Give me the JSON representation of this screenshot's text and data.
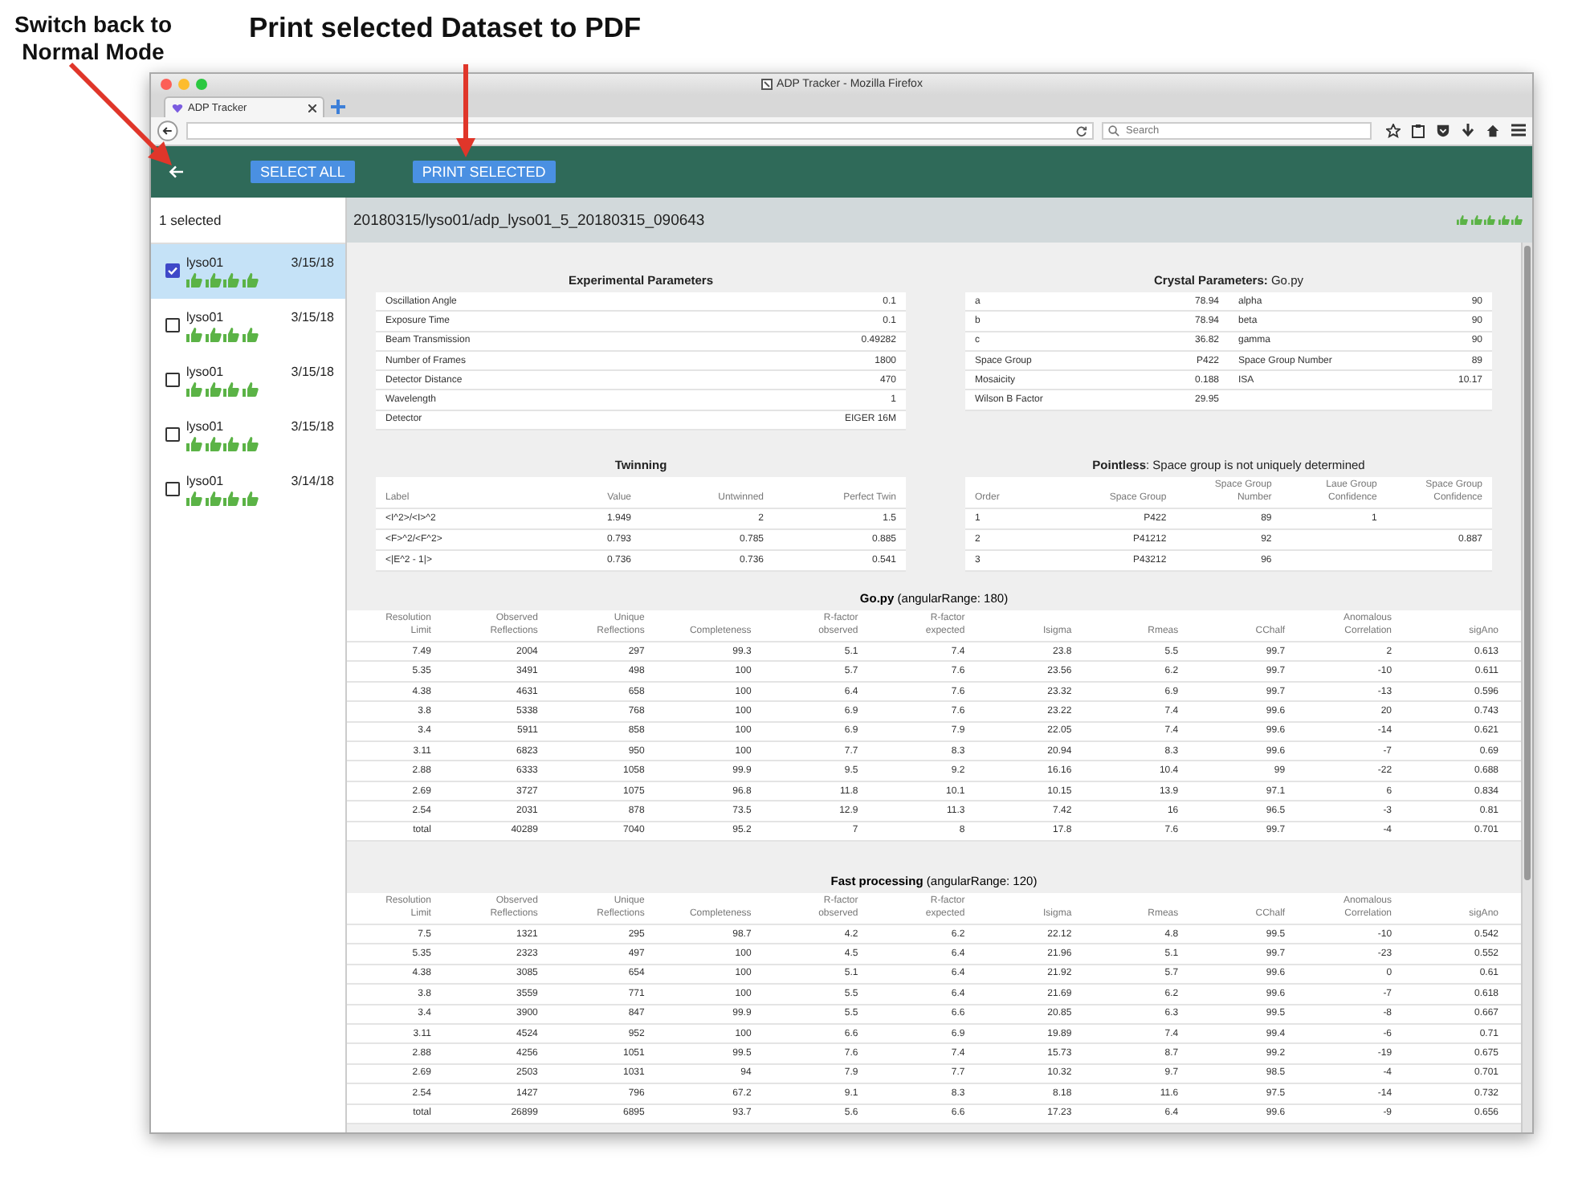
{
  "annotations": [
    {
      "text": "Switch back to Normal Mode"
    },
    {
      "text": "Print selected Dataset to PDF"
    }
  ],
  "browser": {
    "window_title": "ADP Tracker - Mozilla Firefox",
    "tab_title": "ADP Tracker",
    "search_placeholder": "Search"
  },
  "toolbar": {
    "buttons": [
      "SELECT ALL",
      "PRINT SELECTED"
    ]
  },
  "sidebar": {
    "header": "1 selected",
    "items": [
      {
        "name": "lyso01",
        "date": "3/15/18",
        "checked": true,
        "selected": true,
        "stars": 4
      },
      {
        "name": "lyso01",
        "date": "3/15/18",
        "checked": false,
        "selected": false,
        "stars": 4
      },
      {
        "name": "lyso01",
        "date": "3/15/18",
        "checked": false,
        "selected": false,
        "stars": 4
      },
      {
        "name": "lyso01",
        "date": "3/15/18",
        "checked": false,
        "selected": false,
        "stars": 4
      },
      {
        "name": "lyso01",
        "date": "3/14/18",
        "checked": false,
        "selected": false,
        "stars": 4
      }
    ]
  },
  "detail": {
    "path": "20180315/lyso01/adp_lyso01_5_20180315_090643",
    "stars": 5,
    "experimental": {
      "title": "Experimental Parameters",
      "rows": [
        [
          "Oscillation Angle",
          "0.1"
        ],
        [
          "Exposure Time",
          "0.1"
        ],
        [
          "Beam Transmission",
          "0.49282"
        ],
        [
          "Number of Frames",
          "1800"
        ],
        [
          "Detector Distance",
          "470"
        ],
        [
          "Wavelength",
          "1"
        ],
        [
          "Detector",
          "EIGER 16M"
        ]
      ]
    },
    "crystal": {
      "title": "**Crystal Parameters:** Go.py",
      "rows": [
        [
          "a",
          "78.94",
          "alpha",
          "90"
        ],
        [
          "b",
          "78.94",
          "beta",
          "90"
        ],
        [
          "c",
          "36.82",
          "gamma",
          "90"
        ],
        [
          "Space Group",
          "P422",
          "Space Group Number",
          "89"
        ],
        [
          "Mosaicity",
          "0.188",
          "ISA",
          "10.17"
        ],
        [
          "Wilson B Factor",
          "29.95"
        ]
      ]
    },
    "twinning": {
      "title": "Twinning",
      "columns": [
        "Label",
        "Value",
        "Untwinned",
        "Perfect Twin"
      ],
      "rows": [
        [
          "<I^2>/<I>^2",
          "1.949",
          "2",
          "1.5"
        ],
        [
          "<F>^2/<F^2>",
          "0.793",
          "0.785",
          "0.885"
        ],
        [
          "<|E^2 - 1|>",
          "0.736",
          "0.736",
          "0.541"
        ]
      ]
    },
    "pointless": {
      "title": "**Pointless**: Space group is not uniquely determined",
      "columns": [
        "Order",
        "Space Group",
        "Space Group Number",
        "Laue Group Confidence",
        "Space Group Confidence"
      ],
      "rows": [
        [
          "1",
          "P422",
          "89",
          "1",
          null
        ],
        [
          "2",
          "P41212",
          "92",
          null,
          "0.887"
        ],
        [
          "3",
          "P43212",
          "96",
          null,
          null
        ]
      ]
    },
    "processing": [
      {
        "title": "**Go.py** (angularRange: 180)",
        "columns": [
          "Resolution Limit",
          "Observed Reflections",
          "Unique Reflections",
          "Completeness",
          "R-factor observed",
          "R-factor expected",
          "Isigma",
          "Rmeas",
          "CChalf",
          "Anomalous Correlation",
          "sigAno"
        ],
        "rows": [
          [
            "7.49",
            "2004",
            "297",
            "99.3",
            "5.1",
            "7.4",
            "23.8",
            "5.5",
            "99.7",
            "2",
            "0.613"
          ],
          [
            "5.35",
            "3491",
            "498",
            "100",
            "5.7",
            "7.6",
            "23.56",
            "6.2",
            "99.7",
            "-10",
            "0.611"
          ],
          [
            "4.38",
            "4631",
            "658",
            "100",
            "6.4",
            "7.6",
            "23.32",
            "6.9",
            "99.7",
            "-13",
            "0.596"
          ],
          [
            "3.8",
            "5338",
            "768",
            "100",
            "6.9",
            "7.6",
            "23.22",
            "7.4",
            "99.6",
            "20",
            "0.743"
          ],
          [
            "3.4",
            "5911",
            "858",
            "100",
            "6.9",
            "7.9",
            "22.05",
            "7.4",
            "99.6",
            "-14",
            "0.621"
          ],
          [
            "3.11",
            "6823",
            "950",
            "100",
            "7.7",
            "8.3",
            "20.94",
            "8.3",
            "99.6",
            "-7",
            "0.69"
          ],
          [
            "2.88",
            "6333",
            "1058",
            "99.9",
            "9.5",
            "9.2",
            "16.16",
            "10.4",
            "99",
            "-22",
            "0.688"
          ],
          [
            "2.69",
            "3727",
            "1075",
            "96.8",
            "11.8",
            "10.1",
            "10.15",
            "13.9",
            "97.1",
            "6",
            "0.834"
          ],
          [
            "2.54",
            "2031",
            "878",
            "73.5",
            "12.9",
            "11.3",
            "7.42",
            "16",
            "96.5",
            "-3",
            "0.81"
          ],
          [
            "total",
            "40289",
            "7040",
            "95.2",
            "7",
            "8",
            "17.8",
            "7.6",
            "99.7",
            "-4",
            "0.701"
          ]
        ]
      },
      {
        "title": "**Fast processing** (angularRange: 120)",
        "columns": [
          "Resolution Limit",
          "Observed Reflections",
          "Unique Reflections",
          "Completeness",
          "R-factor observed",
          "R-factor expected",
          "Isigma",
          "Rmeas",
          "CChalf",
          "Anomalous Correlation",
          "sigAno"
        ],
        "rows": [
          [
            "7.5",
            "1321",
            "295",
            "98.7",
            "4.2",
            "6.2",
            "22.12",
            "4.8",
            "99.5",
            "-10",
            "0.542"
          ],
          [
            "5.35",
            "2323",
            "497",
            "100",
            "4.5",
            "6.4",
            "21.96",
            "5.1",
            "99.7",
            "-23",
            "0.552"
          ],
          [
            "4.38",
            "3085",
            "654",
            "100",
            "5.1",
            "6.4",
            "21.92",
            "5.7",
            "99.6",
            "0",
            "0.61"
          ],
          [
            "3.8",
            "3559",
            "771",
            "100",
            "5.5",
            "6.4",
            "21.69",
            "6.2",
            "99.6",
            "-7",
            "0.618"
          ],
          [
            "3.4",
            "3900",
            "847",
            "99.9",
            "5.5",
            "6.6",
            "20.85",
            "6.3",
            "99.5",
            "-8",
            "0.667"
          ],
          [
            "3.11",
            "4524",
            "952",
            "100",
            "6.6",
            "6.9",
            "19.89",
            "7.4",
            "99.4",
            "-6",
            "0.71"
          ],
          [
            "2.88",
            "4256",
            "1051",
            "99.5",
            "7.6",
            "7.4",
            "15.73",
            "8.7",
            "99.2",
            "-19",
            "0.675"
          ],
          [
            "2.69",
            "2503",
            "1031",
            "94",
            "7.9",
            "7.7",
            "10.32",
            "9.7",
            "98.5",
            "-4",
            "0.701"
          ],
          [
            "2.54",
            "1427",
            "796",
            "67.2",
            "9.1",
            "8.3",
            "8.18",
            "11.6",
            "97.5",
            "-14",
            "0.732"
          ],
          [
            "total",
            "26899",
            "6895",
            "93.7",
            "5.6",
            "6.6",
            "17.23",
            "6.4",
            "99.6",
            "-9",
            "0.656"
          ]
        ]
      }
    ]
  }
}
